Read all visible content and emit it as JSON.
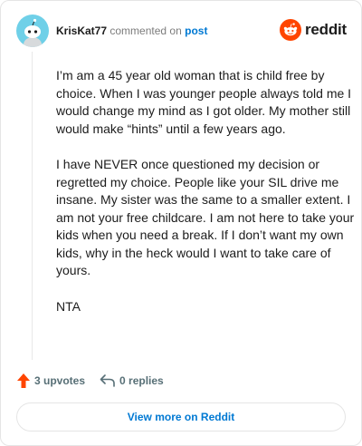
{
  "header": {
    "username": "KrisKat77",
    "commented_text": "commented on",
    "post_link": "post",
    "avatar_icon": "snoo-avatar-icon",
    "avatar_color": "#6fd0e8"
  },
  "brand": {
    "logo_icon": "reddit-logo-icon",
    "wordmark": "reddit",
    "accent": "#ff4500"
  },
  "comment": {
    "paragraphs": [
      "I’m am a 45 year old woman that is child free by choice. When I was younger people always told me I would change my mind as I got older. My mother still would make “hints” until a few years ago.",
      "I have NEVER once questioned my decision or regretted my choice. People like your SIL drive me insane. My sister was the same to a smaller extent. I am not your free childcare. I am not here to take your kids when you need a break. If I don’t want my own kids, why in the heck would I want to take care of yours.",
      "NTA"
    ]
  },
  "actions": {
    "upvotes": "3 upvotes",
    "replies": "0 replies",
    "upvote_icon": "upvote-arrow-icon",
    "reply_icon": "reply-arrow-icon",
    "upvote_color": "#ff4500"
  },
  "footer": {
    "view_more": "View more on Reddit"
  }
}
